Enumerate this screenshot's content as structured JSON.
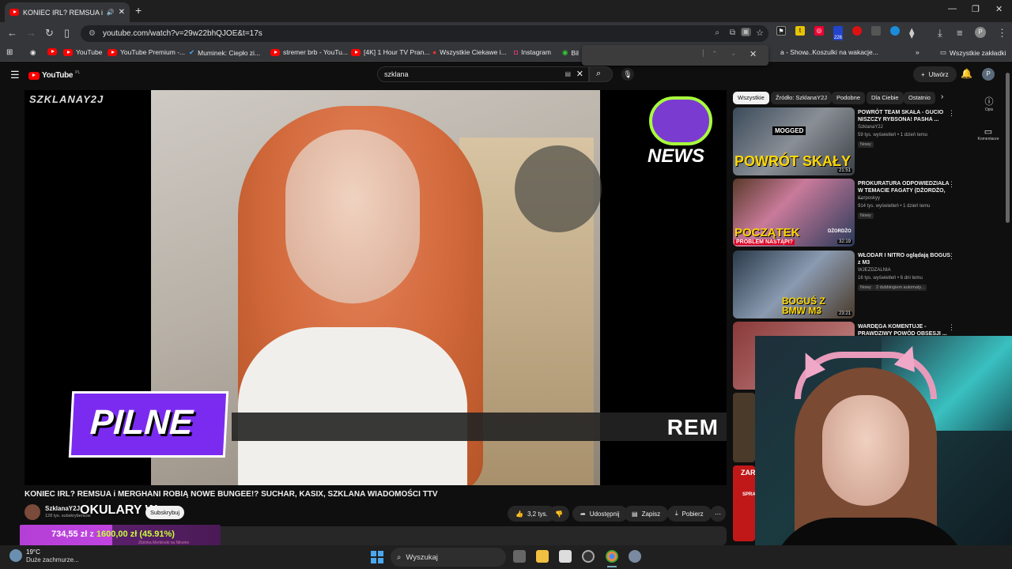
{
  "browser": {
    "tab_title": "KONIEC IRL? REMSUA i MER",
    "new_tab": "+",
    "url": "youtube.com/watch?v=29w22bhQJOE&t=17s",
    "bookmarks": [
      "YouTube",
      "YouTube Premium -...",
      "Muminek: Ciepło zi...",
      "stremer brb - YouTu...",
      "[4K] 1 Hour TV Pran...",
      "Wszystkie Ciekawe i...",
      "Instagram",
      "Bil",
      "a - Show...",
      "Koszulki na wakacje...",
      "Wszystkie zakładki"
    ],
    "ext_badge": "226"
  },
  "youtube": {
    "logo": "YouTube",
    "logo_region": "PL",
    "search_value": "szklana",
    "create_label": "Utwórz",
    "avatar_letter": "P",
    "chips": [
      "Wszystkie",
      "Źródło: SzklanaY2J",
      "Podobne",
      "Dla Ciebie",
      "Ostatnio"
    ],
    "side_actions": [
      "Opis",
      "Komentarze"
    ],
    "video": {
      "title": "KONIEC IRL? REMSUA i MERGHANI ROBIĄ NOWE BUNGEE!? SUCHAR, KASIX, SZKLANA WIADOMOŚCI TTV",
      "overlay_brand": "SZKLANAY2J",
      "overlay_news": "NEWS",
      "banner_label": "PILNE",
      "ticker_text": "REM",
      "channel": "SzklanaY2J",
      "subscribers": "128 tys. subskrybentów",
      "subscribe_label": "Subskrybuj",
      "likes": "3,2 tys.",
      "share": "Udostępnij",
      "save": "Zapisz",
      "download": "Pobierz"
    },
    "recommendations": [
      {
        "title": "POWRÓT TEAM SKAŁA - GUCIO NISZCZY RYBSONA! PASHA ...",
        "channel": "SzklanaY2J",
        "views": "59 tys. wyświetleń • 1 dzień temu",
        "badge": "Nowy",
        "duration": "21:51",
        "thumb_text": "POWRÓT SKAŁY",
        "thumb_tag": "MOGGED"
      },
      {
        "title": "PROKURATURA ODPOWIEDZIAŁA W TEMACIE FAGATY (DŻORDŻO, ...",
        "channel": "Korposkyy",
        "views": "914 tys. wyświetleń • 1 dzień temu",
        "badge": "Nowy",
        "duration": "32:19",
        "thumb_text": "POCZĄTEK",
        "thumb_sub": "PROBLEM NASTĄPI?",
        "thumb_tag": "DŻORDŻO"
      },
      {
        "title": "WŁODAR I NITRO oglądają BOGUS z M3",
        "channel": "WJEZDZALNIA",
        "views": "16 tys. wyświetleń • 6 dni temu",
        "badge": "Nowy",
        "badge2": "2 dubbingiem automaty...",
        "duration": "23:21",
        "thumb_text": "BOGUŚ Z BMW M3"
      },
      {
        "title": "WARDĘGA KOMENTUJE - PRAWDZIWY POWÓD OBSESJI ...",
        "channel": "",
        "views": "",
        "badge": "",
        "duration": ""
      }
    ]
  },
  "stream_overlay": {
    "okulary": "OKULARY W",
    "goal_current": "734,55 zł",
    "goal_sep": "z",
    "goal_target": "1600,00 zł",
    "goal_pct": "(45.91%)",
    "goal_sub": "Zbiórka Merkinski na Nikonie",
    "side_banner": "ZAR",
    "side_banner2": "SPRA"
  },
  "taskbar": {
    "temp": "19°C",
    "weather": "Duże zachmurze...",
    "search": "Wyszukaj"
  }
}
